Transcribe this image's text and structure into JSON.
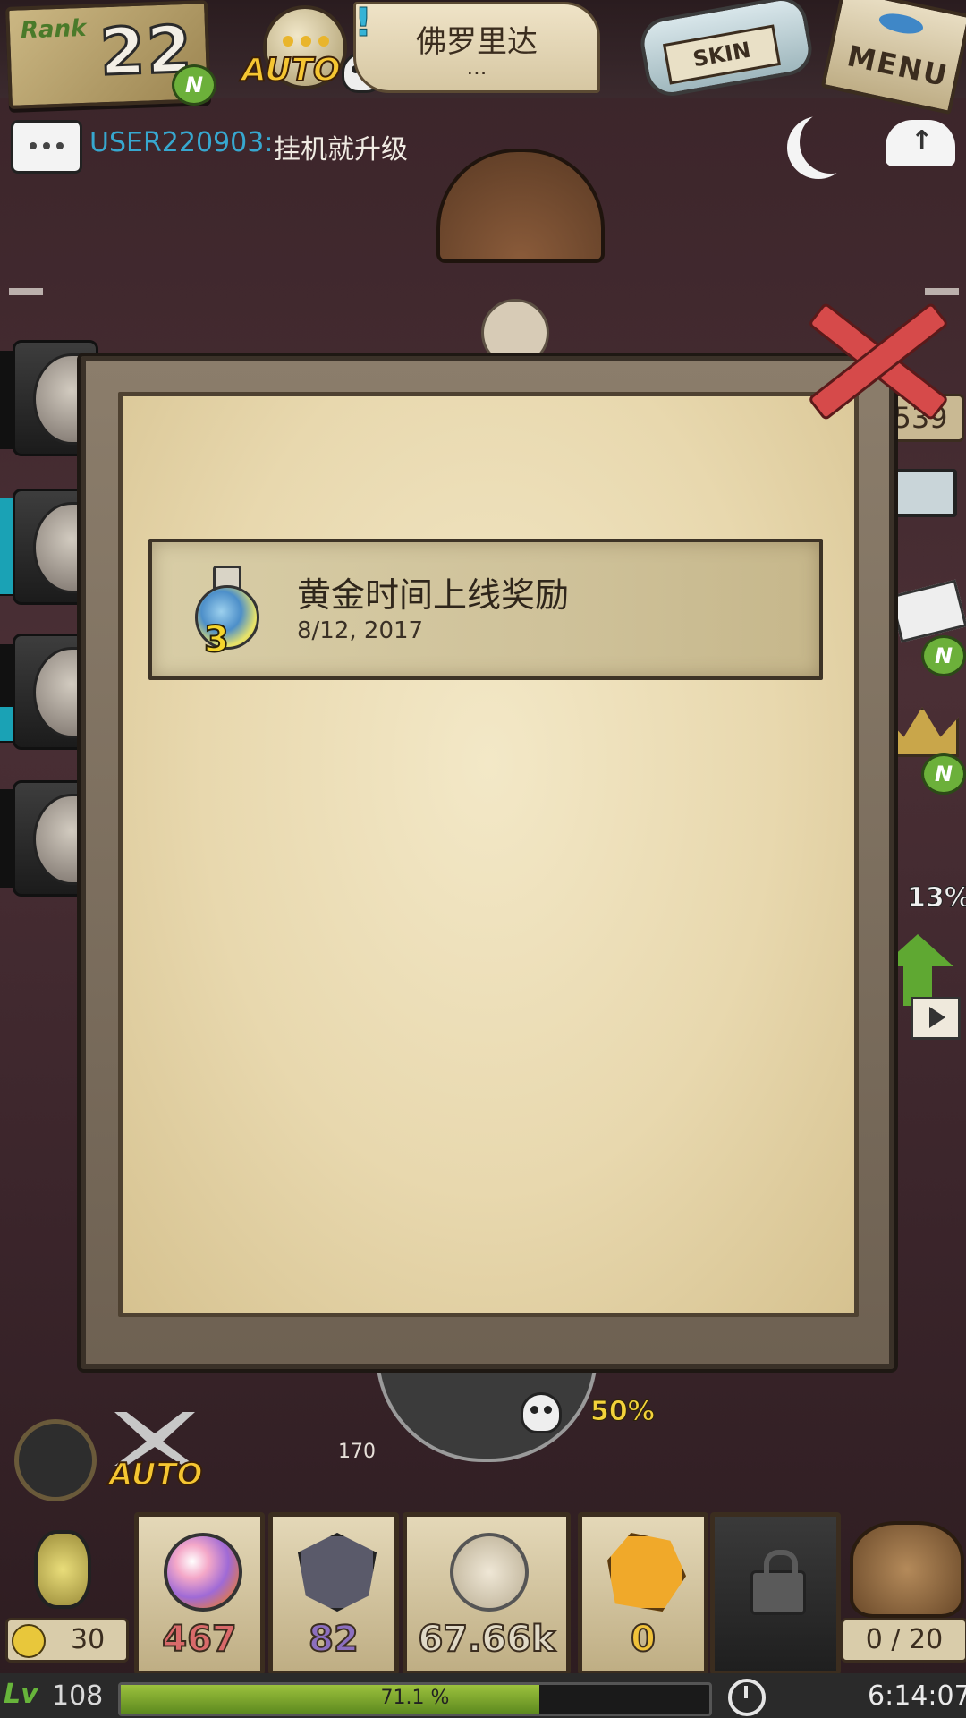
{
  "header": {
    "rank_label": "Rank",
    "rank_value": "22",
    "rank_badge": "N",
    "auto_label": "AUTO",
    "exclaim": "!",
    "location_name": "佛罗里达",
    "location_sub": "...",
    "skin_label": "SKIN",
    "menu_label": "MENU"
  },
  "chat": {
    "user": "USER220903:",
    "message": "挂机就升级"
  },
  "side": {
    "meat_count": "539",
    "badge_n": "N",
    "percent_13": "13%"
  },
  "modal": {
    "mail_items": [
      {
        "title": "黄金时间上线奖励",
        "date": "8/12, 2017",
        "reward_count": "3",
        "icon": "potion-icon"
      }
    ]
  },
  "bottom": {
    "distance_label": "170",
    "boost_percent": "50%",
    "auto_label": "AUTO",
    "coins": "30",
    "resources": [
      {
        "name": "orb",
        "value": "467",
        "color": "#d96a6a"
      },
      {
        "name": "shield",
        "value": "82",
        "color": "#8c6fbf"
      },
      {
        "name": "shell",
        "value": "67.66k",
        "color": "#e0d9c6"
      },
      {
        "name": "gem",
        "value": "0",
        "color": "#f0c23a"
      }
    ],
    "bag_count": "0 / 20"
  },
  "status": {
    "level": "108",
    "xp_percent": "71.1 %",
    "xp_fraction": 0.711,
    "time": "6:14:07"
  },
  "colors": {
    "chat_user": "#37a7cf",
    "xp_fill": "#7aa62b",
    "close_red": "#d64a4a"
  }
}
